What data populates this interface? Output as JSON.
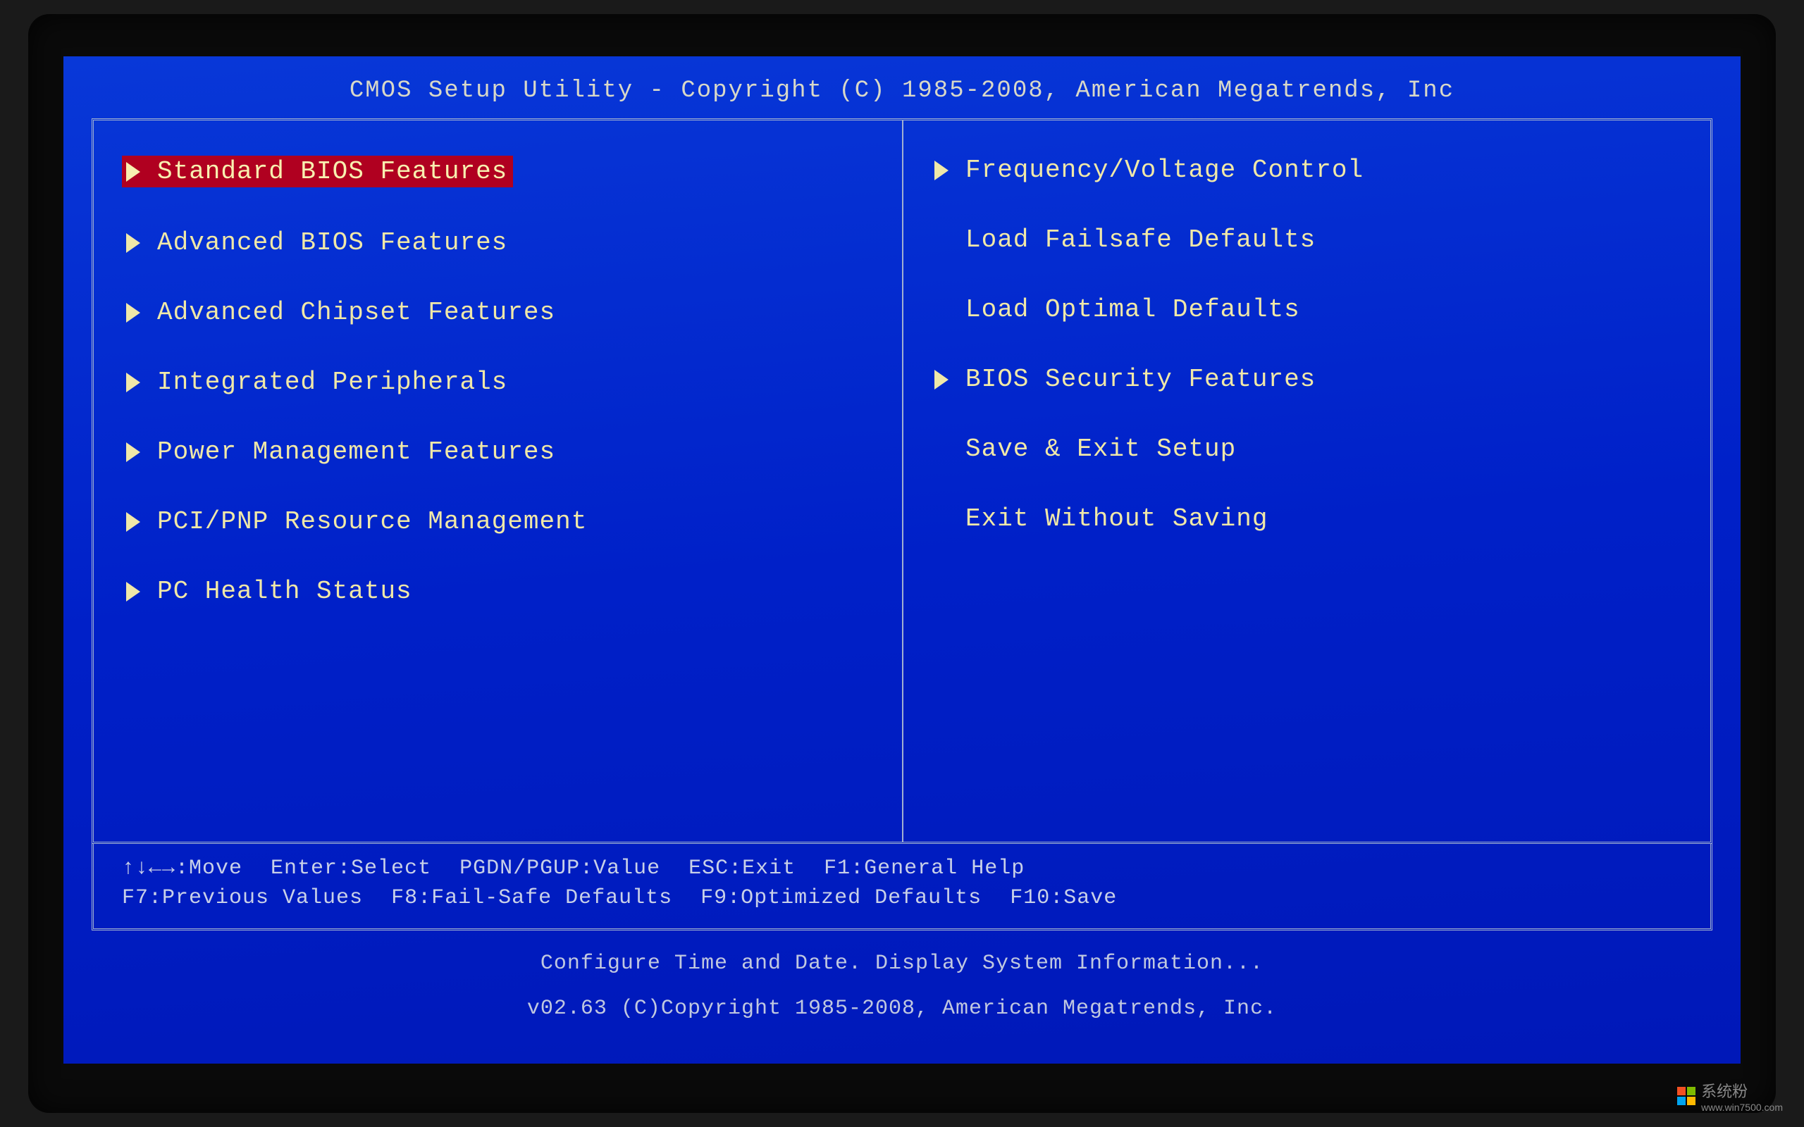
{
  "title": "CMOS Setup Utility - Copyright (C) 1985-2008, American Megatrends, Inc",
  "menu": {
    "left": [
      {
        "label": "Standard BIOS Features",
        "arrow": true,
        "selected": true
      },
      {
        "label": "Advanced BIOS Features",
        "arrow": true,
        "selected": false
      },
      {
        "label": "Advanced Chipset Features",
        "arrow": true,
        "selected": false
      },
      {
        "label": "Integrated Peripherals",
        "arrow": true,
        "selected": false
      },
      {
        "label": "Power Management Features",
        "arrow": true,
        "selected": false
      },
      {
        "label": "PCI/PNP Resource Management",
        "arrow": true,
        "selected": false
      },
      {
        "label": "PC Health Status",
        "arrow": true,
        "selected": false
      }
    ],
    "right": [
      {
        "label": "Frequency/Voltage Control",
        "arrow": true,
        "selected": false
      },
      {
        "label": "Load Failsafe Defaults",
        "arrow": false,
        "selected": false
      },
      {
        "label": "Load Optimal Defaults",
        "arrow": false,
        "selected": false
      },
      {
        "label": "BIOS Security Features",
        "arrow": true,
        "selected": false
      },
      {
        "label": "Save & Exit Setup",
        "arrow": false,
        "selected": false
      },
      {
        "label": "Exit Without Saving",
        "arrow": false,
        "selected": false
      }
    ]
  },
  "help": {
    "line1": {
      "move": "↑↓←→:Move",
      "select": "Enter:Select",
      "value": "PGDN/PGUP:Value",
      "exit": "ESC:Exit",
      "general": "F1:General Help"
    },
    "line2": {
      "prev": "F7:Previous Values",
      "failsafe": "F8:Fail-Safe Defaults",
      "optimized": "F9:Optimized Defaults",
      "save": "F10:Save"
    }
  },
  "info": {
    "description": "Configure Time and Date.  Display System Information...",
    "version": "v02.63 (C)Copyright 1985-2008, American Megatrends, Inc."
  },
  "watermark": {
    "text": "系统粉",
    "url": "www.win7500.com"
  }
}
